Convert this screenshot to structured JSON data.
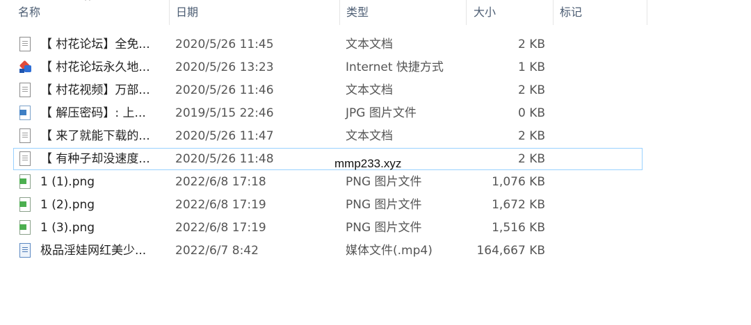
{
  "columns": {
    "name": "名称",
    "date": "日期",
    "type": "类型",
    "size": "大小",
    "tags": "标记"
  },
  "sort_indicator": "^",
  "files": [
    {
      "name": "【 村花论坛】全免...",
      "date": "2020/5/26 11:45",
      "type": "文本文档",
      "size": "2 KB",
      "icon": "text-file-icon"
    },
    {
      "name": "【 村花论坛永久地...",
      "date": "2020/5/26 13:23",
      "type": "Internet 快捷方式",
      "size": "1 KB",
      "icon": "internet-shortcut-icon"
    },
    {
      "name": "【 村花视频】万部...",
      "date": "2020/5/26 11:46",
      "type": "文本文档",
      "size": "2 KB",
      "icon": "text-file-icon"
    },
    {
      "name": "【 解压密码】: 上...",
      "date": "2019/5/15 22:46",
      "type": "JPG 图片文件",
      "size": "0 KB",
      "icon": "jpg-file-icon"
    },
    {
      "name": "【 来了就能下载的...",
      "date": "2020/5/26 11:47",
      "type": "文本文档",
      "size": "2 KB",
      "icon": "text-file-icon"
    },
    {
      "name": "【 有种子却没速度...",
      "date": "2020/5/26 11:48",
      "type": "",
      "size": "2 KB",
      "icon": "text-file-icon",
      "selected": true
    },
    {
      "name": "1 (1).png",
      "date": "2022/6/8 17:18",
      "type": "PNG 图片文件",
      "size": "1,076 KB",
      "icon": "png-file-icon"
    },
    {
      "name": "1 (2).png",
      "date": "2022/6/8 17:19",
      "type": "PNG 图片文件",
      "size": "1,672 KB",
      "icon": "png-file-icon"
    },
    {
      "name": "1 (3).png",
      "date": "2022/6/8 17:19",
      "type": "PNG 图片文件",
      "size": "1,516 KB",
      "icon": "png-file-icon"
    },
    {
      "name": "极品淫娃网红美少...",
      "date": "2022/6/7 8:42",
      "type": "媒体文件(.mp4)",
      "size": "164,667 KB",
      "icon": "video-file-icon"
    }
  ],
  "watermark": "mmp233.xyz"
}
